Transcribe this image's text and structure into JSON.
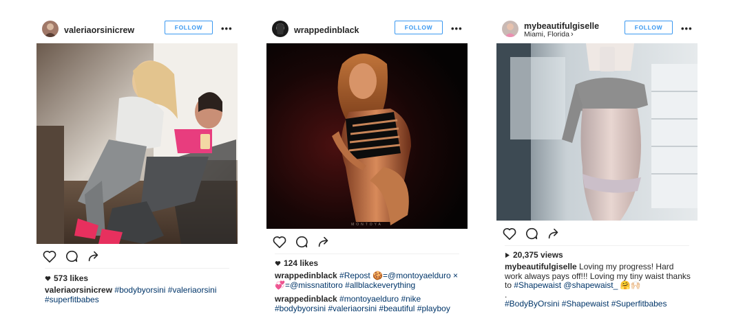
{
  "posts": [
    {
      "username": "valeriaorsinicrew",
      "follow_label": "FOLLOW",
      "more_label": "•••",
      "likes": "573 likes",
      "caption": {
        "user": "valeriaorsinicrew",
        "line1_tags": "#bodybyorsini #valeriaorsini",
        "line2_tags": "#superfitbabes"
      },
      "photo": {
        "subject": "two women taking a gym mirror selfie"
      }
    },
    {
      "username": "wrappedinblack",
      "follow_label": "FOLLOW",
      "more_label": "•••",
      "likes": "124 likes",
      "photo_watermark": "MONTOYA",
      "caption1": {
        "user": "wrappedinblack",
        "repost": "#Repost",
        "emoji": "🍪",
        "rest1": "=@montoyaelduro ×",
        "emoji2": "💞",
        "rest2": "=@missnatitoro #allblackeverything"
      },
      "caption2": {
        "user": "wrappedinblack",
        "line1_tags": "#montoyaelduro #nike",
        "line2_tags": "#bodybyorsini #valeriaorsini #beautiful #playboy"
      },
      "photo": {
        "subject": "woman in black swimsuit against dark background"
      }
    },
    {
      "username": "mybeautifulgiselle",
      "location": "Miami, Florida",
      "follow_label": "FOLLOW",
      "more_label": "•••",
      "views": "20,375 views",
      "caption": {
        "user": "mybeautifulgiselle",
        "line1": "Loving my progress! Hard",
        "line2": "work always pays off!!! Loving my tiny waist thanks",
        "line3a": "to",
        "line3_tag1": "#Shapewaist",
        "line3_tag2": "@shapewaist_",
        "line3_emoji": "🤗🙌🏻",
        "line4": ".",
        "line5_tags": "#BodyByOrsini #Shapewaist #Superfitbabes"
      },
      "photo": {
        "subject": "woman mirror selfie in crop top"
      }
    }
  ],
  "icons": [
    "heart-icon",
    "comment-icon",
    "share-icon",
    "more-icon",
    "play-icon",
    "heart-filled-icon"
  ],
  "colors": {
    "accent": "#3897f0",
    "hashtag": "#003569",
    "text": "#262626"
  }
}
